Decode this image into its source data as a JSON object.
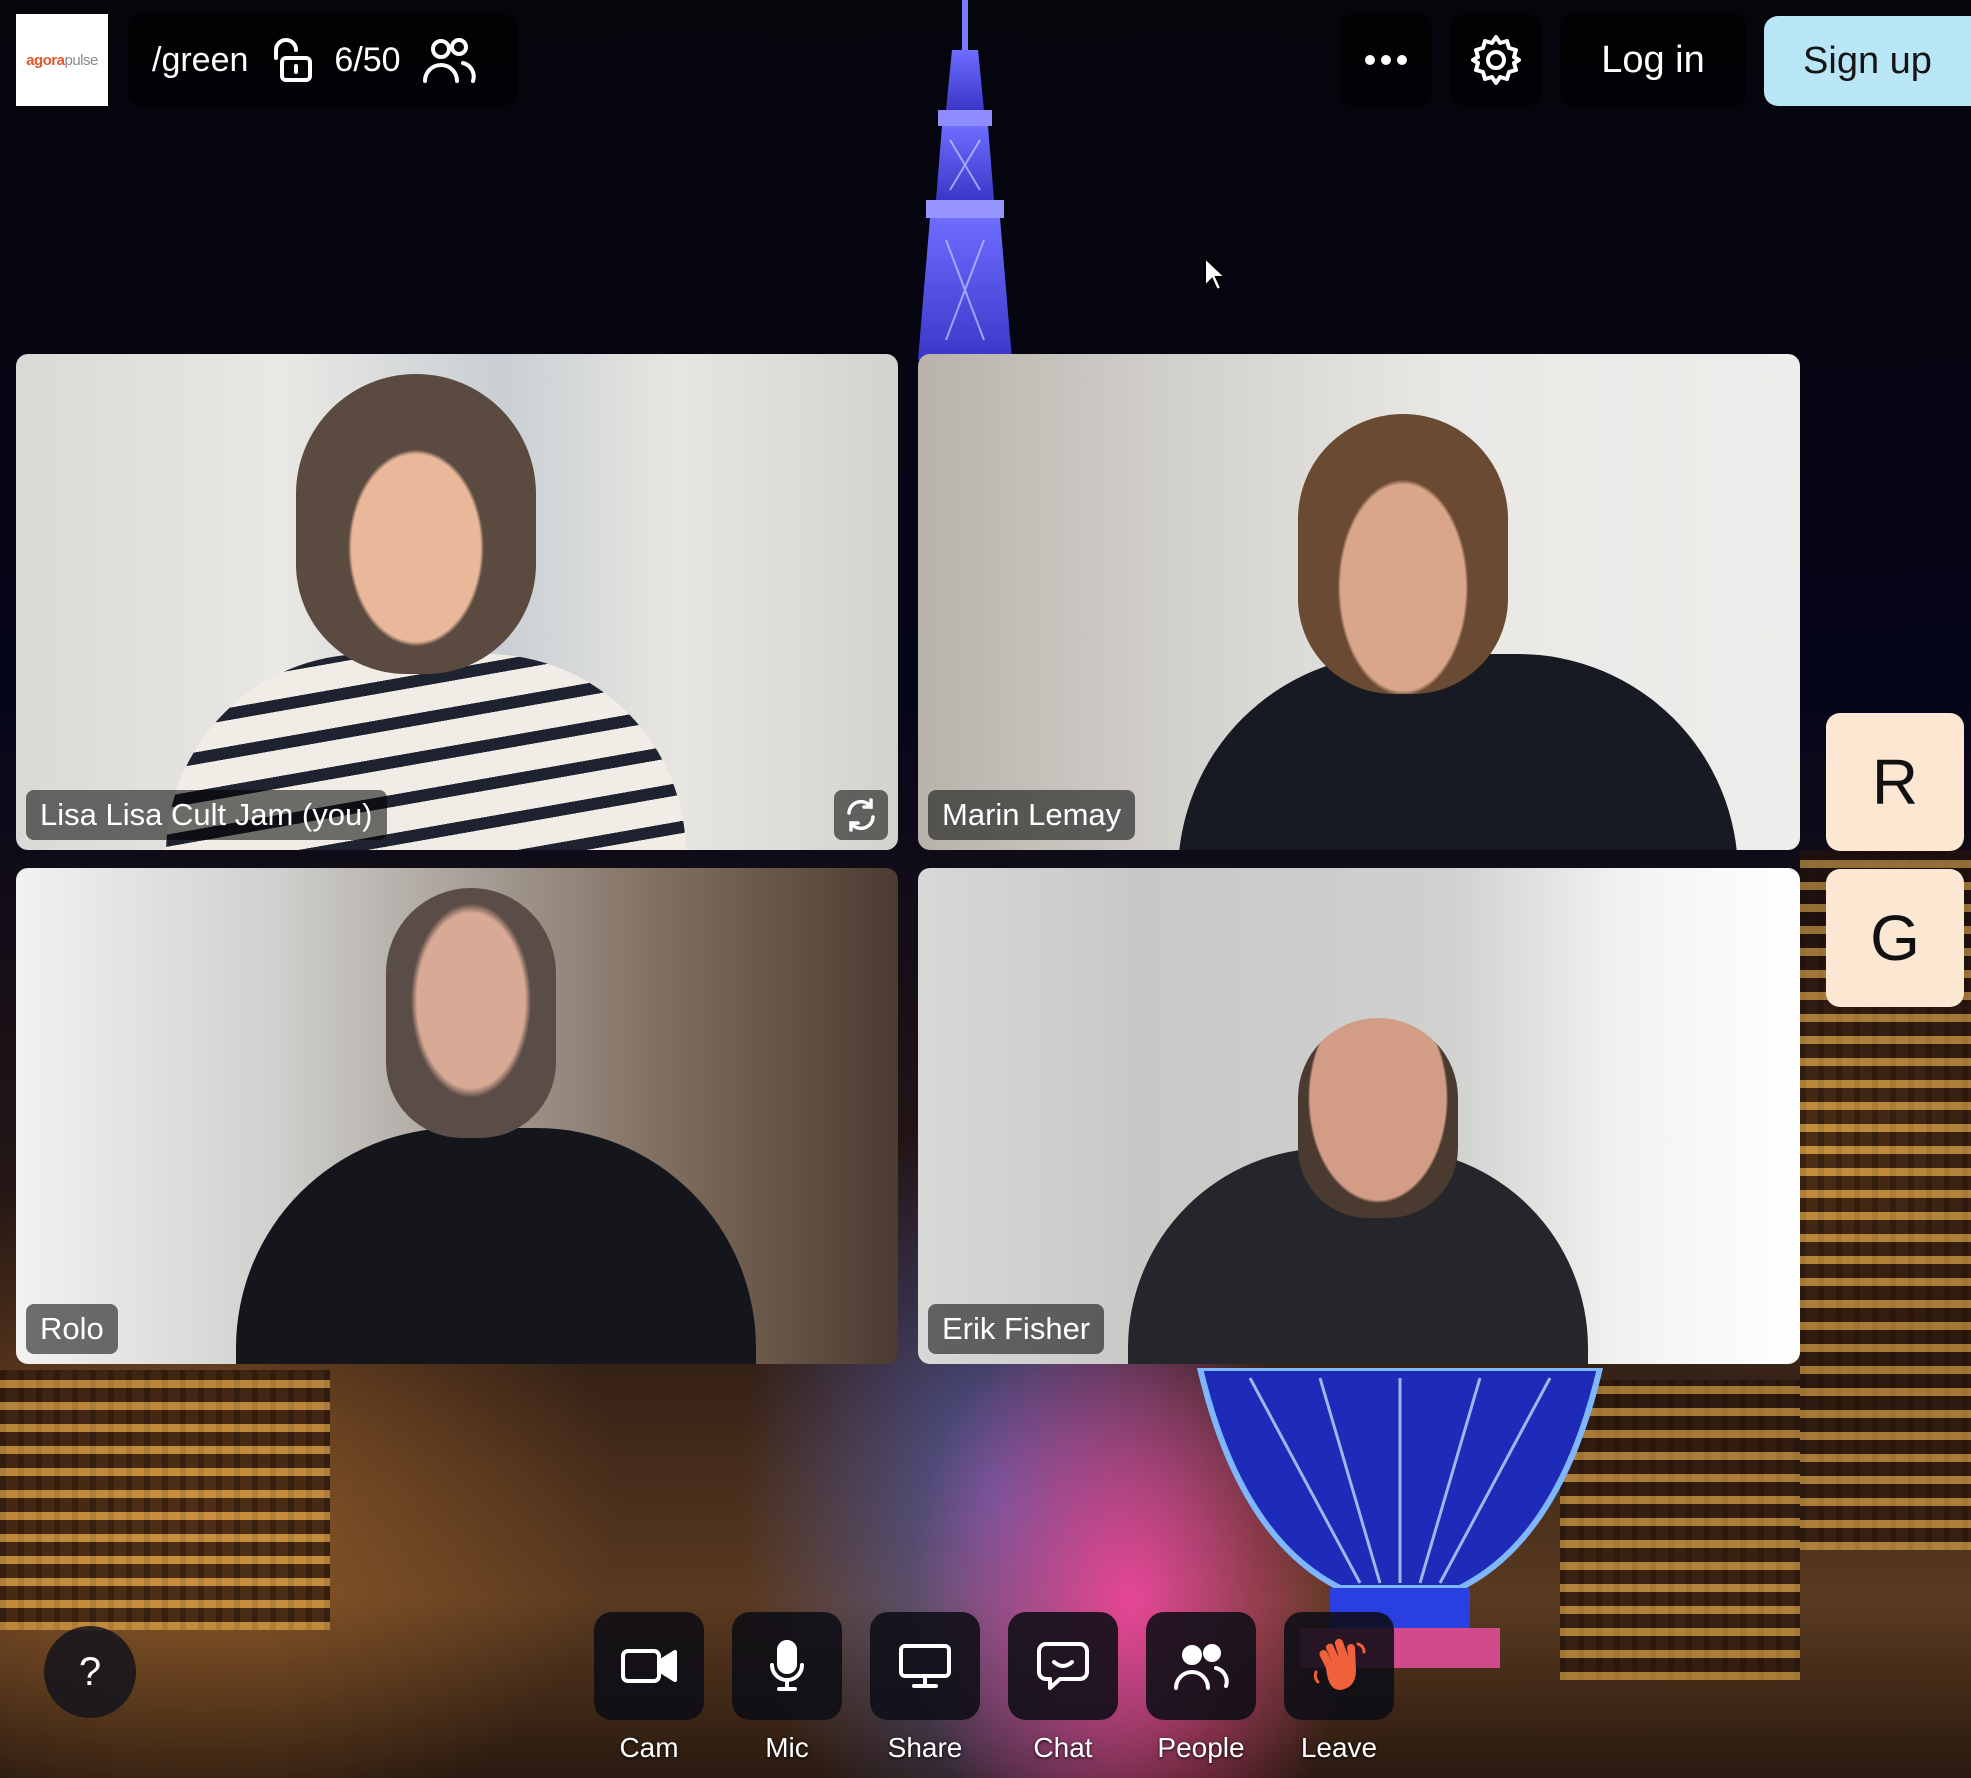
{
  "header": {
    "logo": {
      "part1": "agora",
      "part2": "pulse"
    },
    "room_name": "/green",
    "lock_icon": "unlocked-padlock-icon",
    "participant_count": "6/50",
    "people_icon": "people-icon",
    "more_icon": "more-horizontal-icon",
    "settings_icon": "gear-icon",
    "login_label": "Log in",
    "signup_label": "Sign up"
  },
  "tiles": [
    {
      "name": "Lisa Lisa Cult Jam (you)",
      "has_flip": true,
      "flip_icon": "camera-flip-icon"
    },
    {
      "name": "Marin Lemay"
    },
    {
      "name": "Rolo"
    },
    {
      "name": "Erik Fisher"
    }
  ],
  "side_participants": [
    "R",
    "G"
  ],
  "help": {
    "label": "?"
  },
  "controls": [
    {
      "label": "Cam",
      "icon": "camera-icon"
    },
    {
      "label": "Mic",
      "icon": "microphone-icon"
    },
    {
      "label": "Share",
      "icon": "screen-share-icon"
    },
    {
      "label": "Chat",
      "icon": "chat-icon"
    },
    {
      "label": "People",
      "icon": "people-icon"
    },
    {
      "label": "Leave",
      "icon": "waving-hand-icon"
    }
  ],
  "colors": {
    "signup_bg": "#b8e6f6",
    "side_tile_bg": "#fbe7d2",
    "leave_icon": "#f0603a",
    "tower_glow": "#5a5cff"
  }
}
